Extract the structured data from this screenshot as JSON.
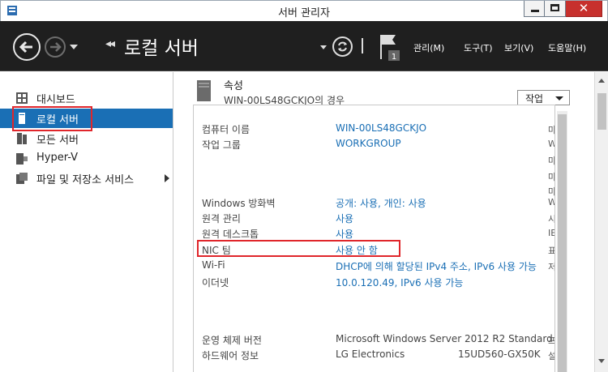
{
  "window": {
    "title": "서버 관리자",
    "close_glyph": "✕"
  },
  "header": {
    "crumb_arrows": "◂◂",
    "page_title": "로컬 서버",
    "flag_count": "1",
    "menus": [
      "관리(M)",
      "도구(T)",
      "보기(V)",
      "도움말(H)"
    ]
  },
  "sidebar": {
    "items": [
      {
        "label": "대시보드",
        "icon": "dashboard-icon"
      },
      {
        "label": "로컬 서버",
        "icon": "server-icon",
        "active": true
      },
      {
        "label": "모든 서버",
        "icon": "servers-icon"
      },
      {
        "label": "Hyper-V",
        "icon": "hyperv-icon"
      },
      {
        "label": "파일 및 저장소 서비스",
        "icon": "storage-icon"
      }
    ]
  },
  "main": {
    "section_title": "속성",
    "section_subtitle": "WIN-00LS48GCKJO의 경우",
    "tasks_label": "작업",
    "properties": [
      {
        "label": "컴퓨터 이름",
        "value": "WIN-00LS48GCKJO",
        "edge": "마"
      },
      {
        "label": "작업 그룹",
        "value": "WORKGROUP",
        "edge": "W"
      },
      {
        "label": "Windows 방화벽",
        "value": "공개: 사용, 개인: 사용",
        "edge": "W"
      },
      {
        "label": "원격 관리",
        "value": "사용",
        "edge": "시"
      },
      {
        "label": "원격 데스크톱",
        "value": "사용",
        "edge": "IE"
      },
      {
        "label": "NIC 팀",
        "value": "사용 안 함",
        "edge": "표"
      },
      {
        "label": "Wi-Fi",
        "value": "DHCP에 의해 할당된 IPv4 주소, IPv6 사용 가능",
        "edge": "저"
      },
      {
        "label": "이더넷",
        "value": "10.0.120.49, IPv6 사용 가능",
        "edge": ""
      },
      {
        "label": "운영 체제 버전",
        "value": "Microsoft Windows Server 2012 R2 Standard",
        "edge": "프"
      },
      {
        "label": "하드웨어 정보",
        "value": "LG Electronics",
        "value2": "15UD560-GX50K",
        "edge": "설"
      }
    ],
    "edge_extra": [
      "마",
      "마",
      "마"
    ]
  },
  "colors": {
    "accent": "#1a6fb5",
    "header_bg": "#1f1f1f",
    "highlight_red": "#e0262b",
    "close_red": "#c7302d"
  }
}
